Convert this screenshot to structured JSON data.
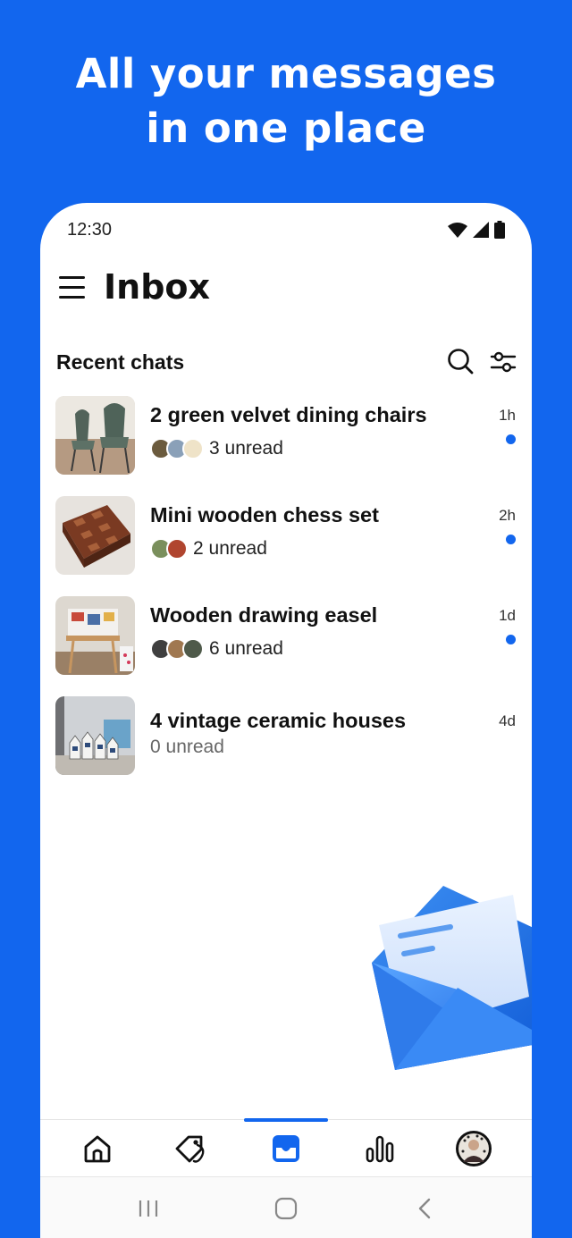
{
  "promo": {
    "headline_line1": "All your messages",
    "headline_line2": "in one place"
  },
  "status_bar": {
    "time": "12:30",
    "icons": [
      "wifi-icon",
      "signal-icon",
      "battery-icon"
    ]
  },
  "app_bar": {
    "title": "Inbox",
    "menu_icon": "hamburger-menu-icon"
  },
  "section": {
    "title": "Recent chats",
    "search_icon": "search-icon",
    "filter_icon": "filter-sliders-icon"
  },
  "chats": [
    {
      "title": "2 green velvet dining chairs",
      "unread": "3 unread",
      "time": "1h",
      "has_dot": true,
      "avatar_count": 3
    },
    {
      "title": "Mini wooden chess set",
      "unread": "2 unread",
      "time": "2h",
      "has_dot": true,
      "avatar_count": 2
    },
    {
      "title": "Wooden drawing easel",
      "unread": "6 unread",
      "time": "1d",
      "has_dot": true,
      "avatar_count": 3
    },
    {
      "title": "4 vintage ceramic houses",
      "unread": "0 unread",
      "time": "4d",
      "has_dot": false,
      "avatar_count": 0
    }
  ],
  "bottom_nav": {
    "items": [
      "home-icon",
      "tag-icon",
      "inbox-icon",
      "stats-icon",
      "profile-avatar"
    ],
    "active": "inbox-icon"
  },
  "system_nav": {
    "items": [
      "recents-icon",
      "home-circle-icon",
      "back-icon"
    ]
  },
  "colors": {
    "brand_blue": "#1266ee",
    "unread_dot": "#1266ee",
    "text_primary": "#111111",
    "text_muted": "#666666"
  }
}
